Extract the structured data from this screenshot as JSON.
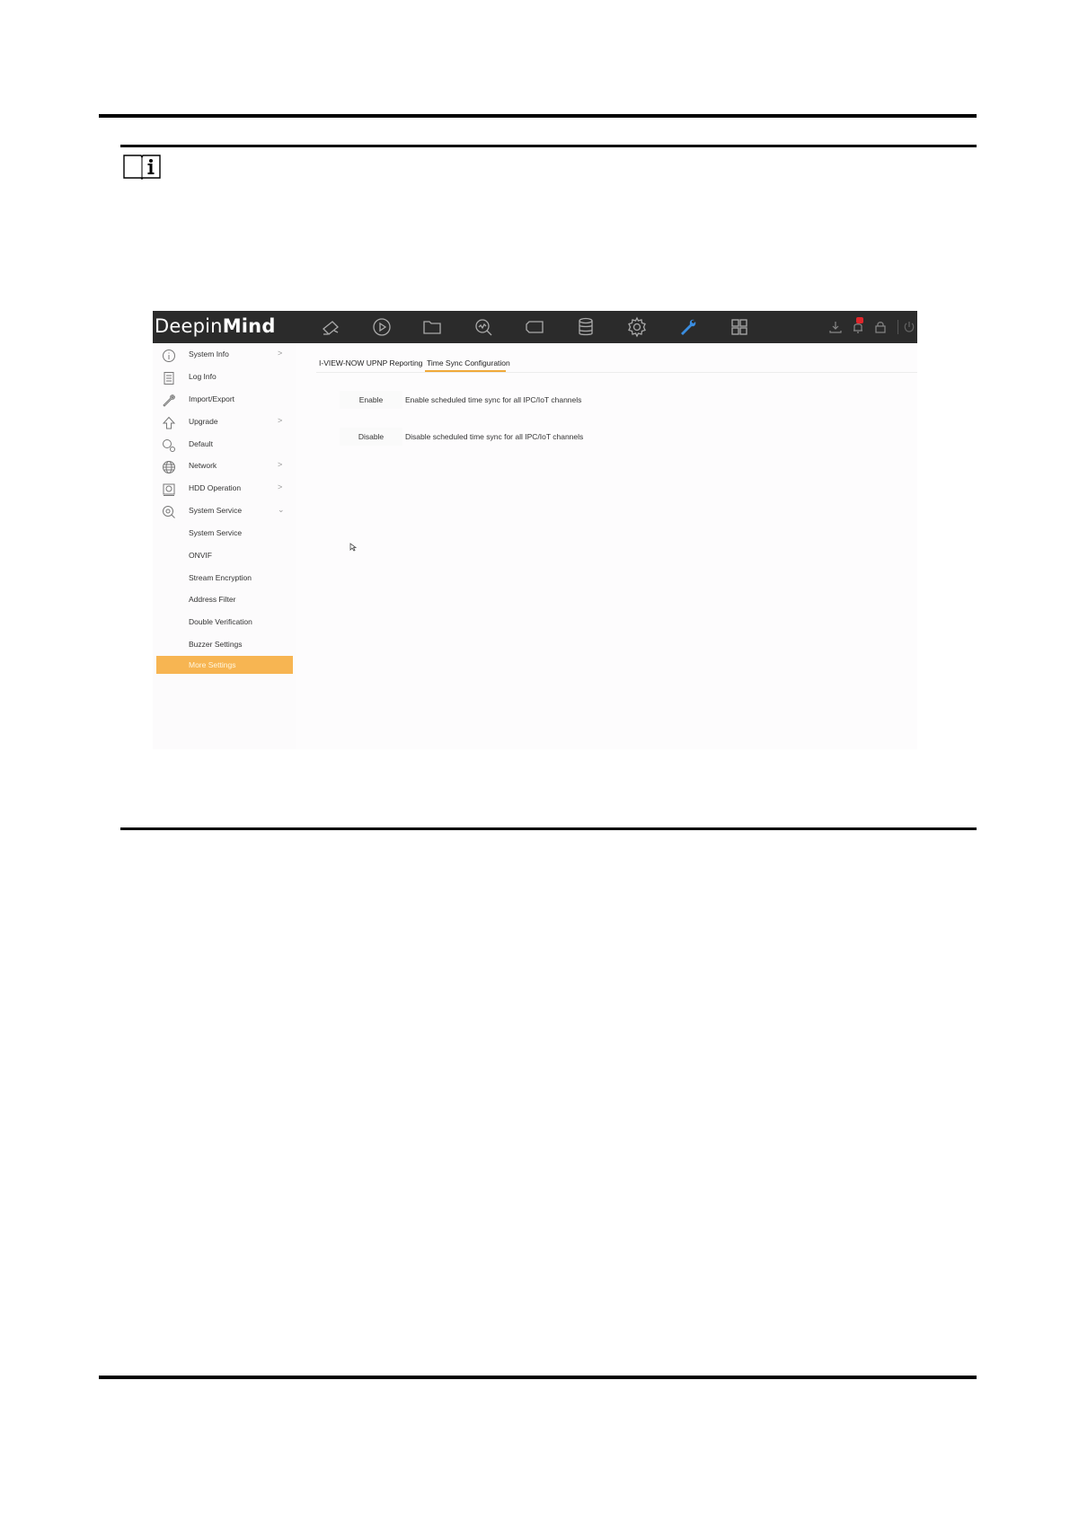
{
  "app": {
    "logo_light": "Deepin",
    "logo_bold": "Mind"
  },
  "topnav": {
    "icons": [
      "live-view-icon",
      "playback-icon",
      "file-icon",
      "smart-search-icon",
      "camera-icon",
      "storage-icon",
      "settings-icon",
      "maintenance-icon",
      "apps-grid-icon"
    ],
    "right_icons": [
      "download-icon",
      "notification-icon",
      "lock-icon",
      "power-icon"
    ]
  },
  "sidebar": {
    "items": [
      {
        "label": "System Info",
        "icon": "info-icon",
        "chevron": ">"
      },
      {
        "label": "Log Info",
        "icon": "log-icon",
        "chevron": ""
      },
      {
        "label": "Import/Export",
        "icon": "wrench-icon",
        "chevron": ""
      },
      {
        "label": "Upgrade",
        "icon": "upgrade-arrow-icon",
        "chevron": ">"
      },
      {
        "label": "Default",
        "icon": "default-icon",
        "chevron": ""
      },
      {
        "label": "Network",
        "icon": "globe-icon",
        "chevron": ">"
      },
      {
        "label": "HDD Operation",
        "icon": "hdd-icon",
        "chevron": ">"
      },
      {
        "label": "System Service",
        "icon": "service-icon",
        "chevron": "⌄"
      }
    ],
    "subitems": [
      "System Service",
      "ONVIF",
      "Stream Encryption",
      "Address Filter",
      "Double Verification",
      "Buzzer Settings"
    ],
    "active_item": "More Settings"
  },
  "main": {
    "tabs": [
      "I-VIEW-NOW UPNP Reporting",
      "Time Sync Configuration"
    ],
    "active_tab": "Time Sync Configuration",
    "rows": [
      {
        "button": "Enable",
        "description": "Enable scheduled time sync for all IPC/IoT channels"
      },
      {
        "button": "Disable",
        "description": "Disable scheduled time sync for all IPC/IoT channels"
      }
    ]
  },
  "colors": {
    "topbar": "#2b2b2b",
    "accent": "#f7b552",
    "tab_underline": "#f0a93a",
    "maintenance_icon": "#3a8de0",
    "badge": "#e0262b"
  }
}
